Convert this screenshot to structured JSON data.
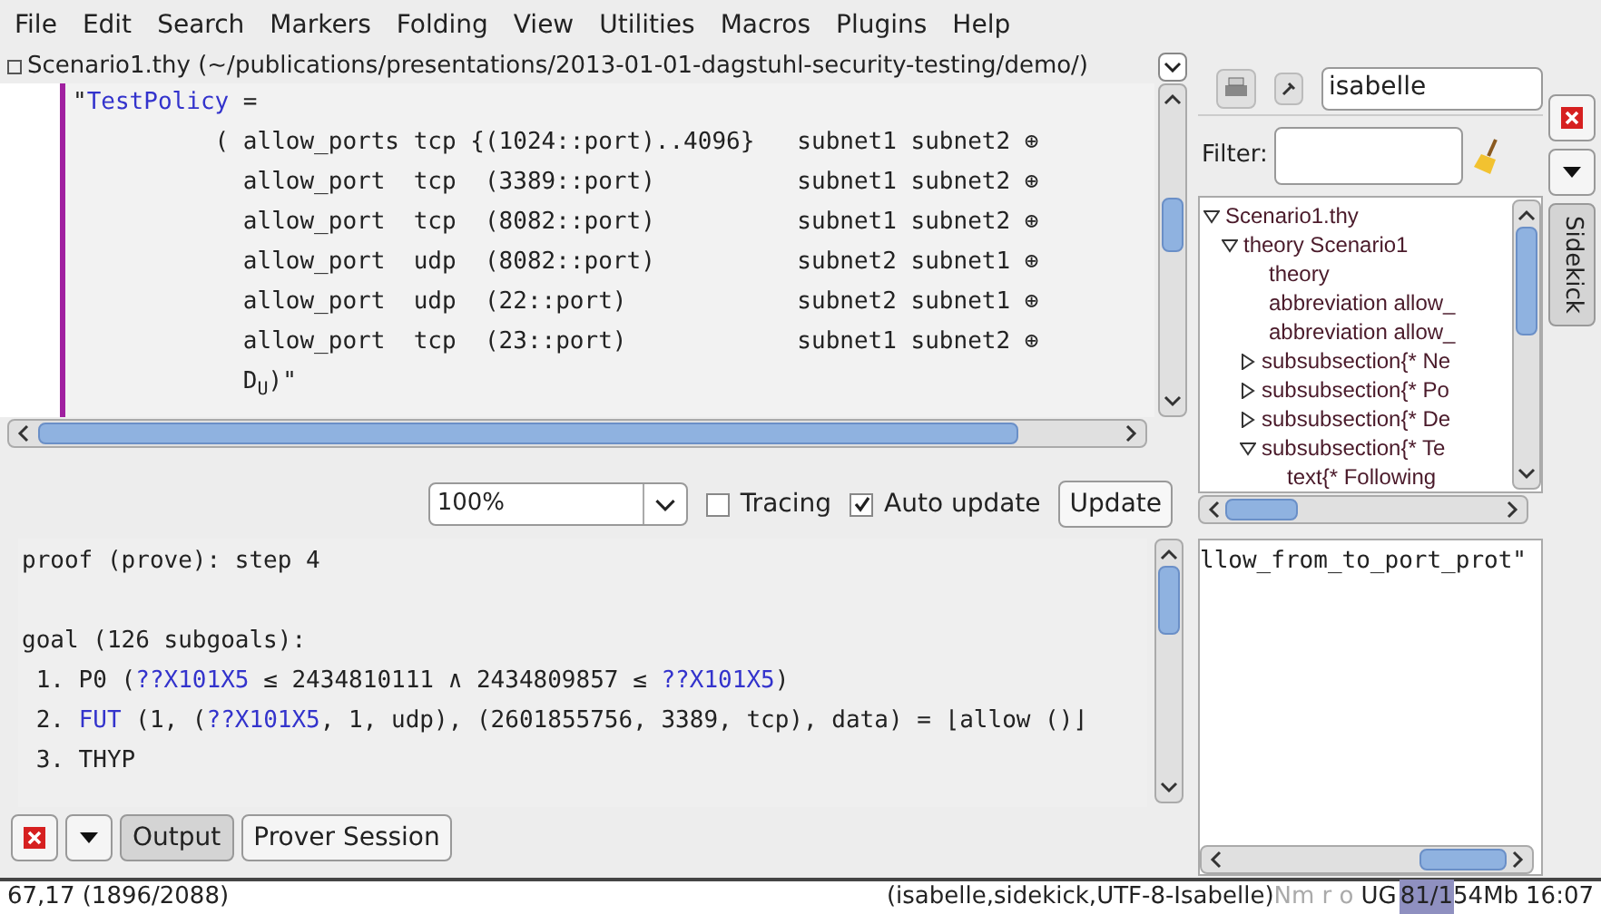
{
  "menu": [
    "File",
    "Edit",
    "Search",
    "Markers",
    "Folding",
    "View",
    "Utilities",
    "Macros",
    "Plugins",
    "Help"
  ],
  "buffer": {
    "title": "Scenario1.thy",
    "path": "(~/publications/presentations/2013-01-01-dagstuhl-security-testing/demo/)"
  },
  "editor": {
    "lines": [
      [
        {
          "text": "\"",
          "kind": "plain"
        },
        {
          "text": "TestPolicy",
          "kind": "const"
        },
        {
          "text": " =",
          "kind": "plain"
        }
      ],
      [
        {
          "text": "          ( allow_ports tcp {(1024::port)..4096}   subnet1 subnet2 ⊕",
          "kind": "plain"
        }
      ],
      [
        {
          "text": "            allow_port  tcp  (3389::port)          subnet1 subnet2 ⊕",
          "kind": "plain"
        }
      ],
      [
        {
          "text": "            allow_port  tcp  (8082::port)          subnet1 subnet2 ⊕",
          "kind": "plain"
        }
      ],
      [
        {
          "text": "            allow_port  udp  (8082::port)          subnet2 subnet1 ⊕",
          "kind": "plain"
        }
      ],
      [
        {
          "text": "            allow_port  udp  (22::port)            subnet2 subnet1 ⊕",
          "kind": "plain"
        }
      ],
      [
        {
          "text": "            allow_port  tcp  (23::port)            subnet1 subnet2 ⊕",
          "kind": "plain"
        }
      ],
      [
        {
          "text": "            D",
          "kind": "plain"
        },
        {
          "text": "U",
          "kind": "sub"
        },
        {
          "text": ")\"",
          "kind": "plain"
        }
      ]
    ]
  },
  "output_toolbar": {
    "zoom": "100%",
    "tracing": {
      "label": "Tracing",
      "checked": false
    },
    "auto_update": {
      "label": "Auto update",
      "checked": true
    },
    "update_button": "Update"
  },
  "output": {
    "blocks": [
      [
        [
          {
            "text": "proof (prove): step 4",
            "kind": "plain"
          }
        ]
      ],
      [
        [
          {
            "text": "goal (126 subgoals):",
            "kind": "plain"
          }
        ],
        [
          {
            "text": " 1. P0 (",
            "kind": "plain"
          },
          {
            "text": "??X101X5",
            "kind": "const"
          },
          {
            "text": " ≤ 2434810111 ∧ 2434809857 ≤ ",
            "kind": "plain"
          },
          {
            "text": "??X101X5",
            "kind": "const"
          },
          {
            "text": ")",
            "kind": "plain"
          }
        ],
        [
          {
            "text": " 2. ",
            "kind": "plain"
          },
          {
            "text": "FUT",
            "kind": "const"
          },
          {
            "text": " (1, (",
            "kind": "plain"
          },
          {
            "text": "??X101X5",
            "kind": "const"
          },
          {
            "text": ", 1, udp), (2601855756, 3389, tcp), data) = ⌊allow ()⌋",
            "kind": "plain"
          }
        ],
        [
          {
            "text": " 3. THYP",
            "kind": "plain"
          }
        ]
      ]
    ]
  },
  "dock_tabs": [
    {
      "label": "Output",
      "selected": true
    },
    {
      "label": "Prover Session",
      "selected": false
    }
  ],
  "sidekick": {
    "parser": "isabelle",
    "filter_label": "Filter:",
    "tree": [
      {
        "label": "Scenario1.thy",
        "kind": "node",
        "expanded": true,
        "children": [
          {
            "label": "theory Scenario1",
            "kind": "node",
            "expanded": true,
            "children": [
              {
                "label": "theory",
                "kind": "leaf"
              },
              {
                "label": "abbreviation allow_",
                "kind": "leaf"
              },
              {
                "label": "abbreviation allow_",
                "kind": "leaf"
              },
              {
                "label": "subsubsection{* Ne",
                "kind": "node",
                "expanded": false
              },
              {
                "label": "subsubsection{* Po",
                "kind": "node",
                "expanded": false
              },
              {
                "label": "subsubsection{* De",
                "kind": "node",
                "expanded": false
              },
              {
                "label": "subsubsection{* Te",
                "kind": "node",
                "expanded": true,
                "children": [
                  {
                    "label": "text{* Following",
                    "kind": "leaf"
                  }
                ]
              }
            ]
          }
        ]
      }
    ],
    "preview": "llow_from_to_port_prot\"",
    "tab": "Sidekick"
  },
  "status_bar": {
    "position": "67,17 (1896/2088)",
    "mode": "(isabelle,sidekick,UTF-8-Isabelle)",
    "flags": "Nm r o",
    "encoding_flags": "UG",
    "memory": {
      "text": "81/154Mb",
      "level": 0.45
    },
    "time": "16:07"
  }
}
